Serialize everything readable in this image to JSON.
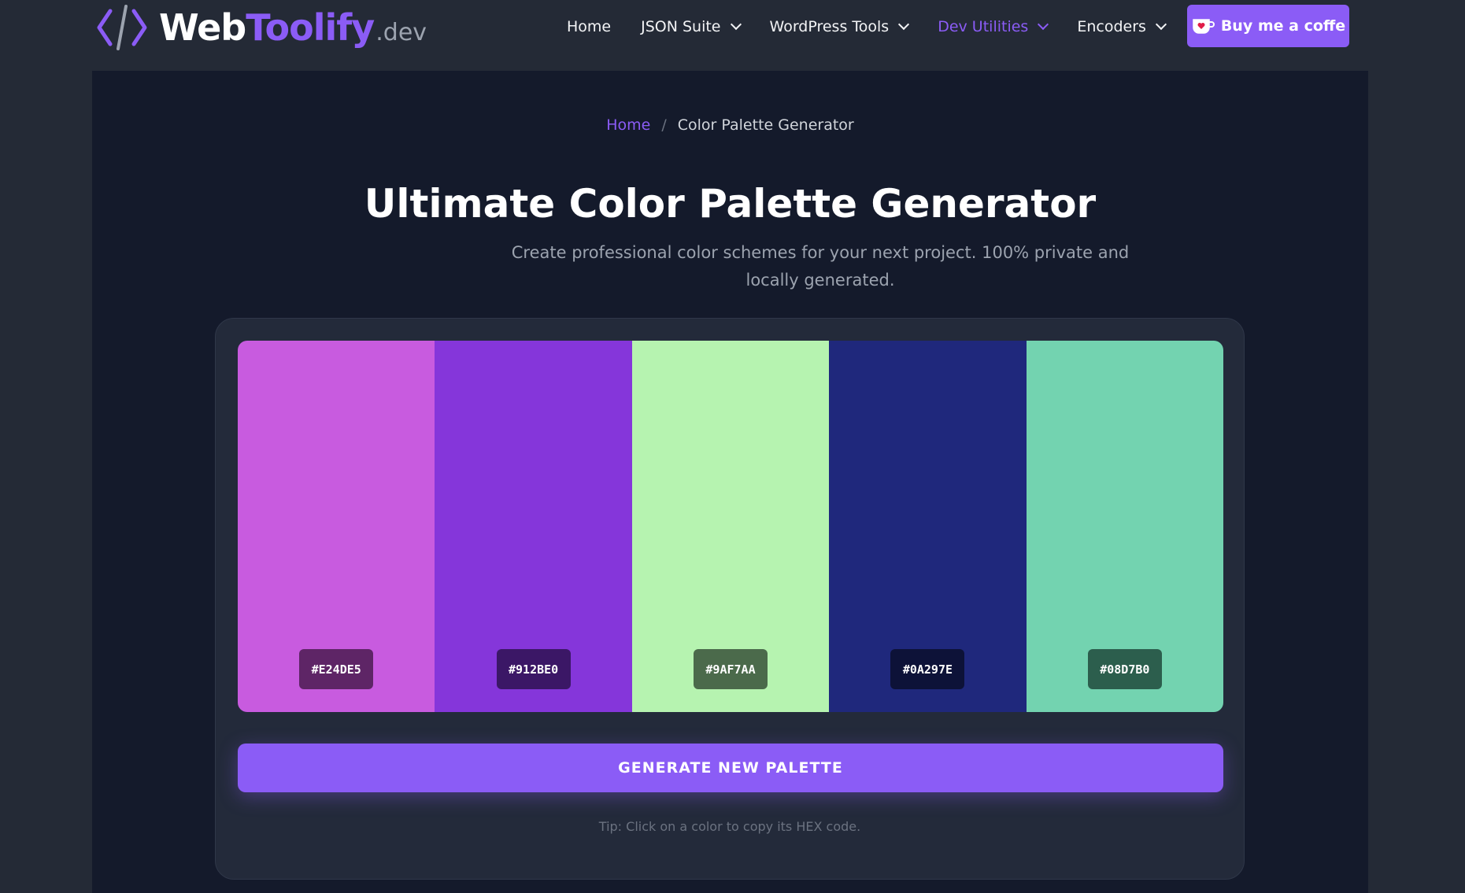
{
  "brand": {
    "name_part1": "Web",
    "name_part2": "Toolify",
    "suffix": ".dev",
    "accent_color": "#8b5cf6"
  },
  "nav": {
    "items": [
      {
        "label": "Home",
        "dropdown": false,
        "active": false
      },
      {
        "label": "JSON Suite",
        "dropdown": true,
        "active": false
      },
      {
        "label": "WordPress Tools",
        "dropdown": true,
        "active": false
      },
      {
        "label": "Dev Utilities",
        "dropdown": true,
        "active": true
      },
      {
        "label": "Encoders",
        "dropdown": true,
        "active": false
      }
    ],
    "cta_label": "Buy me a coffe",
    "cta_icon": "coffee-cup-heart-icon"
  },
  "breadcrumb": {
    "home": "Home",
    "separator": "/",
    "current": "Color Palette Generator"
  },
  "page": {
    "title": "Ultimate Color Palette Generator",
    "subtitle": "Create professional color schemes for your next project. 100% private and locally generated."
  },
  "palette": {
    "swatches": [
      {
        "hex": "#E24DE5",
        "display_color": "#c85bdf",
        "badge_color": "#5e2566"
      },
      {
        "hex": "#912BE0",
        "display_color": "#8536da",
        "badge_color": "#3b1766"
      },
      {
        "hex": "#9AF7AA",
        "display_color": "#b6f3b0",
        "badge_color": "#4b6a4b"
      },
      {
        "hex": "#0A297E",
        "display_color": "#1f287c",
        "badge_color": "#0d1238"
      },
      {
        "hex": "#08D7B0",
        "display_color": "#73d3b0",
        "badge_color": "#2c5e4d"
      }
    ],
    "generate_label": "GENERATE NEW PALETTE",
    "tip": "Tip: Click on a color to copy its HEX code."
  }
}
